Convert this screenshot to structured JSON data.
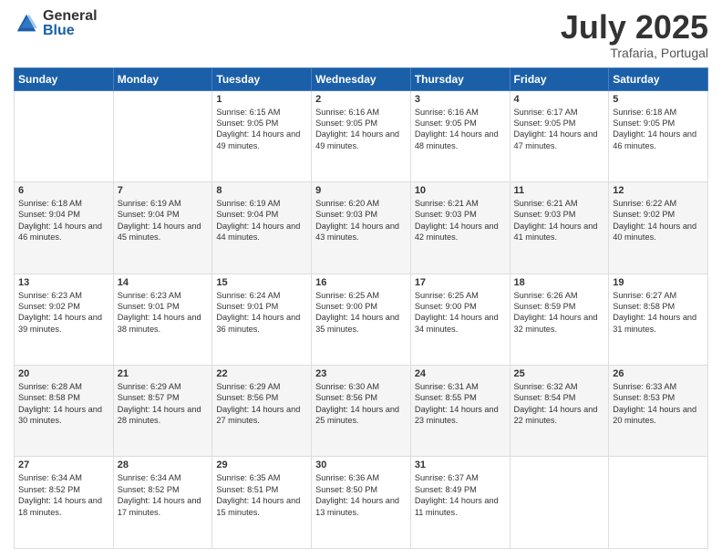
{
  "logo": {
    "general": "General",
    "blue": "Blue"
  },
  "title": "July 2025",
  "location": "Trafaria, Portugal",
  "days_of_week": [
    "Sunday",
    "Monday",
    "Tuesday",
    "Wednesday",
    "Thursday",
    "Friday",
    "Saturday"
  ],
  "weeks": [
    [
      {
        "day": "",
        "sunrise": "",
        "sunset": "",
        "daylight": ""
      },
      {
        "day": "",
        "sunrise": "",
        "sunset": "",
        "daylight": ""
      },
      {
        "day": "1",
        "sunrise": "Sunrise: 6:15 AM",
        "sunset": "Sunset: 9:05 PM",
        "daylight": "Daylight: 14 hours and 49 minutes."
      },
      {
        "day": "2",
        "sunrise": "Sunrise: 6:16 AM",
        "sunset": "Sunset: 9:05 PM",
        "daylight": "Daylight: 14 hours and 49 minutes."
      },
      {
        "day": "3",
        "sunrise": "Sunrise: 6:16 AM",
        "sunset": "Sunset: 9:05 PM",
        "daylight": "Daylight: 14 hours and 48 minutes."
      },
      {
        "day": "4",
        "sunrise": "Sunrise: 6:17 AM",
        "sunset": "Sunset: 9:05 PM",
        "daylight": "Daylight: 14 hours and 47 minutes."
      },
      {
        "day": "5",
        "sunrise": "Sunrise: 6:18 AM",
        "sunset": "Sunset: 9:05 PM",
        "daylight": "Daylight: 14 hours and 46 minutes."
      }
    ],
    [
      {
        "day": "6",
        "sunrise": "Sunrise: 6:18 AM",
        "sunset": "Sunset: 9:04 PM",
        "daylight": "Daylight: 14 hours and 46 minutes."
      },
      {
        "day": "7",
        "sunrise": "Sunrise: 6:19 AM",
        "sunset": "Sunset: 9:04 PM",
        "daylight": "Daylight: 14 hours and 45 minutes."
      },
      {
        "day": "8",
        "sunrise": "Sunrise: 6:19 AM",
        "sunset": "Sunset: 9:04 PM",
        "daylight": "Daylight: 14 hours and 44 minutes."
      },
      {
        "day": "9",
        "sunrise": "Sunrise: 6:20 AM",
        "sunset": "Sunset: 9:03 PM",
        "daylight": "Daylight: 14 hours and 43 minutes."
      },
      {
        "day": "10",
        "sunrise": "Sunrise: 6:21 AM",
        "sunset": "Sunset: 9:03 PM",
        "daylight": "Daylight: 14 hours and 42 minutes."
      },
      {
        "day": "11",
        "sunrise": "Sunrise: 6:21 AM",
        "sunset": "Sunset: 9:03 PM",
        "daylight": "Daylight: 14 hours and 41 minutes."
      },
      {
        "day": "12",
        "sunrise": "Sunrise: 6:22 AM",
        "sunset": "Sunset: 9:02 PM",
        "daylight": "Daylight: 14 hours and 40 minutes."
      }
    ],
    [
      {
        "day": "13",
        "sunrise": "Sunrise: 6:23 AM",
        "sunset": "Sunset: 9:02 PM",
        "daylight": "Daylight: 14 hours and 39 minutes."
      },
      {
        "day": "14",
        "sunrise": "Sunrise: 6:23 AM",
        "sunset": "Sunset: 9:01 PM",
        "daylight": "Daylight: 14 hours and 38 minutes."
      },
      {
        "day": "15",
        "sunrise": "Sunrise: 6:24 AM",
        "sunset": "Sunset: 9:01 PM",
        "daylight": "Daylight: 14 hours and 36 minutes."
      },
      {
        "day": "16",
        "sunrise": "Sunrise: 6:25 AM",
        "sunset": "Sunset: 9:00 PM",
        "daylight": "Daylight: 14 hours and 35 minutes."
      },
      {
        "day": "17",
        "sunrise": "Sunrise: 6:25 AM",
        "sunset": "Sunset: 9:00 PM",
        "daylight": "Daylight: 14 hours and 34 minutes."
      },
      {
        "day": "18",
        "sunrise": "Sunrise: 6:26 AM",
        "sunset": "Sunset: 8:59 PM",
        "daylight": "Daylight: 14 hours and 32 minutes."
      },
      {
        "day": "19",
        "sunrise": "Sunrise: 6:27 AM",
        "sunset": "Sunset: 8:58 PM",
        "daylight": "Daylight: 14 hours and 31 minutes."
      }
    ],
    [
      {
        "day": "20",
        "sunrise": "Sunrise: 6:28 AM",
        "sunset": "Sunset: 8:58 PM",
        "daylight": "Daylight: 14 hours and 30 minutes."
      },
      {
        "day": "21",
        "sunrise": "Sunrise: 6:29 AM",
        "sunset": "Sunset: 8:57 PM",
        "daylight": "Daylight: 14 hours and 28 minutes."
      },
      {
        "day": "22",
        "sunrise": "Sunrise: 6:29 AM",
        "sunset": "Sunset: 8:56 PM",
        "daylight": "Daylight: 14 hours and 27 minutes."
      },
      {
        "day": "23",
        "sunrise": "Sunrise: 6:30 AM",
        "sunset": "Sunset: 8:56 PM",
        "daylight": "Daylight: 14 hours and 25 minutes."
      },
      {
        "day": "24",
        "sunrise": "Sunrise: 6:31 AM",
        "sunset": "Sunset: 8:55 PM",
        "daylight": "Daylight: 14 hours and 23 minutes."
      },
      {
        "day": "25",
        "sunrise": "Sunrise: 6:32 AM",
        "sunset": "Sunset: 8:54 PM",
        "daylight": "Daylight: 14 hours and 22 minutes."
      },
      {
        "day": "26",
        "sunrise": "Sunrise: 6:33 AM",
        "sunset": "Sunset: 8:53 PM",
        "daylight": "Daylight: 14 hours and 20 minutes."
      }
    ],
    [
      {
        "day": "27",
        "sunrise": "Sunrise: 6:34 AM",
        "sunset": "Sunset: 8:52 PM",
        "daylight": "Daylight: 14 hours and 18 minutes."
      },
      {
        "day": "28",
        "sunrise": "Sunrise: 6:34 AM",
        "sunset": "Sunset: 8:52 PM",
        "daylight": "Daylight: 14 hours and 17 minutes."
      },
      {
        "day": "29",
        "sunrise": "Sunrise: 6:35 AM",
        "sunset": "Sunset: 8:51 PM",
        "daylight": "Daylight: 14 hours and 15 minutes."
      },
      {
        "day": "30",
        "sunrise": "Sunrise: 6:36 AM",
        "sunset": "Sunset: 8:50 PM",
        "daylight": "Daylight: 14 hours and 13 minutes."
      },
      {
        "day": "31",
        "sunrise": "Sunrise: 6:37 AM",
        "sunset": "Sunset: 8:49 PM",
        "daylight": "Daylight: 14 hours and 11 minutes."
      },
      {
        "day": "",
        "sunrise": "",
        "sunset": "",
        "daylight": ""
      },
      {
        "day": "",
        "sunrise": "",
        "sunset": "",
        "daylight": ""
      }
    ]
  ]
}
